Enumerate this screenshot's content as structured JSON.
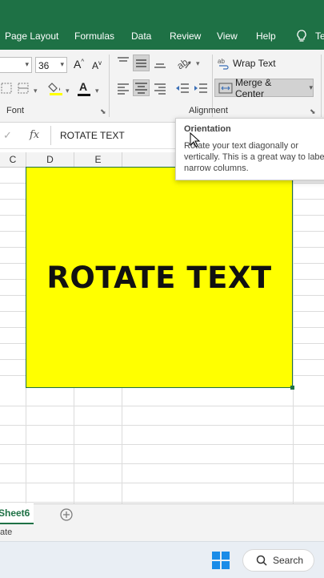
{
  "ribbon_tabs": [
    "Page Layout",
    "Formulas",
    "Data",
    "Review",
    "View",
    "Help",
    "Te"
  ],
  "font": {
    "size_value": "36",
    "grow_label": "A",
    "shrink_label": "A",
    "font_color_label": "A",
    "group_label": "Font"
  },
  "alignment": {
    "wrap_text_label": "Wrap Text",
    "merge_center_label": "Merge & Center",
    "group_label": "Alignment"
  },
  "formula_bar": {
    "fx_label": "fx",
    "content": "ROTATE TEXT"
  },
  "columns": [
    "C",
    "D",
    "E"
  ],
  "merged_cell_text": "ROTATE TEXT",
  "tooltip": {
    "title": "Orientation",
    "body": "Rotate your text diagonally or vertically. This is a great way to label narrow columns."
  },
  "sheet_tab": "Sheet6",
  "status_text": "ate",
  "taskbar": {
    "search_label": "Search"
  },
  "colors": {
    "excel_green": "#1e7145",
    "cell_fill": "#ffff00"
  }
}
